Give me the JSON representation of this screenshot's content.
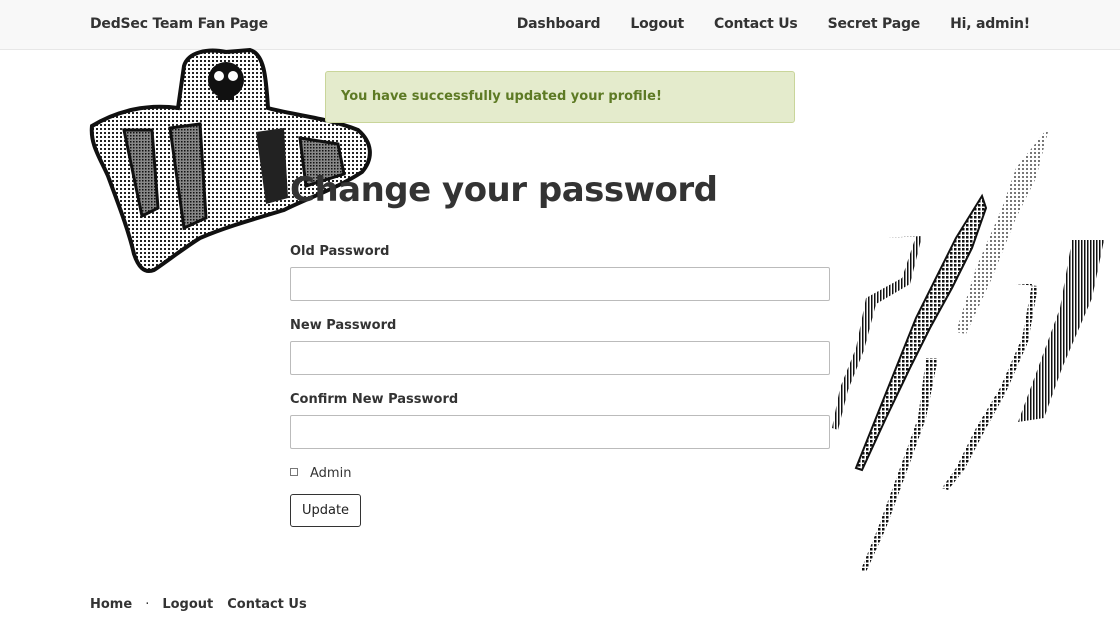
{
  "navbar": {
    "brand": "DedSec Team Fan Page",
    "links": [
      "Dashboard",
      "Logout",
      "Contact Us",
      "Secret Page",
      "Hi, admin!"
    ]
  },
  "flash": {
    "message": "You have successfully updated your profile!"
  },
  "form": {
    "title": "Change your password",
    "old_password_label": "Old Password",
    "old_password_value": "",
    "new_password_label": "New Password",
    "new_password_value": "",
    "confirm_password_label": "Confirm New Password",
    "confirm_password_value": "",
    "admin_label": "Admin",
    "admin_checked": false,
    "submit_label": "Update"
  },
  "footer": {
    "links": [
      "Home",
      "Logout",
      "Contact Us"
    ],
    "separator": "·"
  },
  "colors": {
    "navbar_bg": "#f8f8f8",
    "flash_bg": "#e4ebcc",
    "flash_text": "#5d7a24"
  },
  "decorations": [
    "ghost-skull-ascii-art",
    "lightning-bolt-ascii-art"
  ]
}
